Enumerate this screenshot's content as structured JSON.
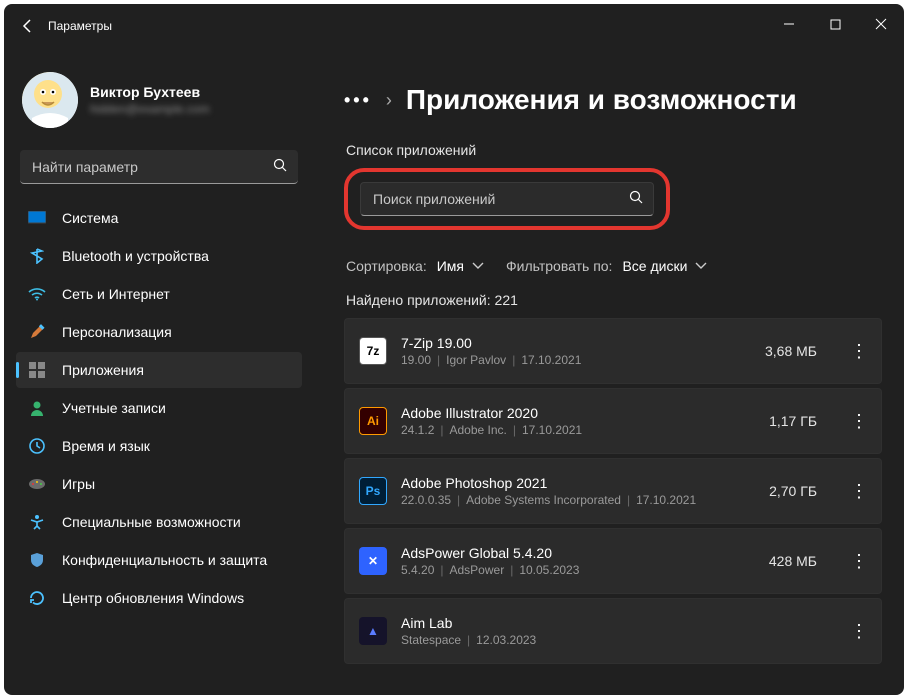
{
  "window": {
    "title": "Параметры"
  },
  "profile": {
    "name": "Виктор Бухтеев",
    "email": "hidden@example.com"
  },
  "search": {
    "placeholder": "Найти параметр"
  },
  "nav": [
    {
      "key": "system",
      "label": "Система"
    },
    {
      "key": "bluetooth",
      "label": "Bluetooth и устройства"
    },
    {
      "key": "network",
      "label": "Сеть и Интернет"
    },
    {
      "key": "personal",
      "label": "Персонализация"
    },
    {
      "key": "apps",
      "label": "Приложения",
      "selected": true
    },
    {
      "key": "accounts",
      "label": "Учетные записи"
    },
    {
      "key": "time",
      "label": "Время и язык"
    },
    {
      "key": "gaming",
      "label": "Игры"
    },
    {
      "key": "access",
      "label": "Специальные возможности"
    },
    {
      "key": "privacy",
      "label": "Конфиденциальность и защита"
    },
    {
      "key": "update",
      "label": "Центр обновления Windows"
    }
  ],
  "header": {
    "page_title": "Приложения и возможности"
  },
  "section": {
    "list_label": "Список приложений",
    "search_placeholder": "Поиск приложений"
  },
  "filters": {
    "sort_label": "Сортировка:",
    "sort_value": "Имя",
    "filter_label": "Фильтровать по:",
    "filter_value": "Все диски"
  },
  "found": {
    "label": "Найдено приложений:",
    "count": "221"
  },
  "apps": [
    {
      "name": "7-Zip 19.00",
      "version": "19.00",
      "publisher": "Igor Pavlov",
      "date": "17.10.2021",
      "size": "3,68 МБ",
      "icon": "7z"
    },
    {
      "name": "Adobe Illustrator 2020",
      "version": "24.1.2",
      "publisher": "Adobe Inc.",
      "date": "17.10.2021",
      "size": "1,17 ГБ",
      "icon": "ai"
    },
    {
      "name": "Adobe Photoshop 2021",
      "version": "22.0.0.35",
      "publisher": "Adobe Systems Incorporated",
      "date": "17.10.2021",
      "size": "2,70 ГБ",
      "icon": "ps"
    },
    {
      "name": "AdsPower Global 5.4.20",
      "version": "5.4.20",
      "publisher": "AdsPower",
      "date": "10.05.2023",
      "size": "428 МБ",
      "icon": "ads"
    },
    {
      "name": "Aim Lab",
      "version": "",
      "publisher": "Statespace",
      "date": "12.03.2023",
      "size": "",
      "icon": "aim"
    }
  ]
}
